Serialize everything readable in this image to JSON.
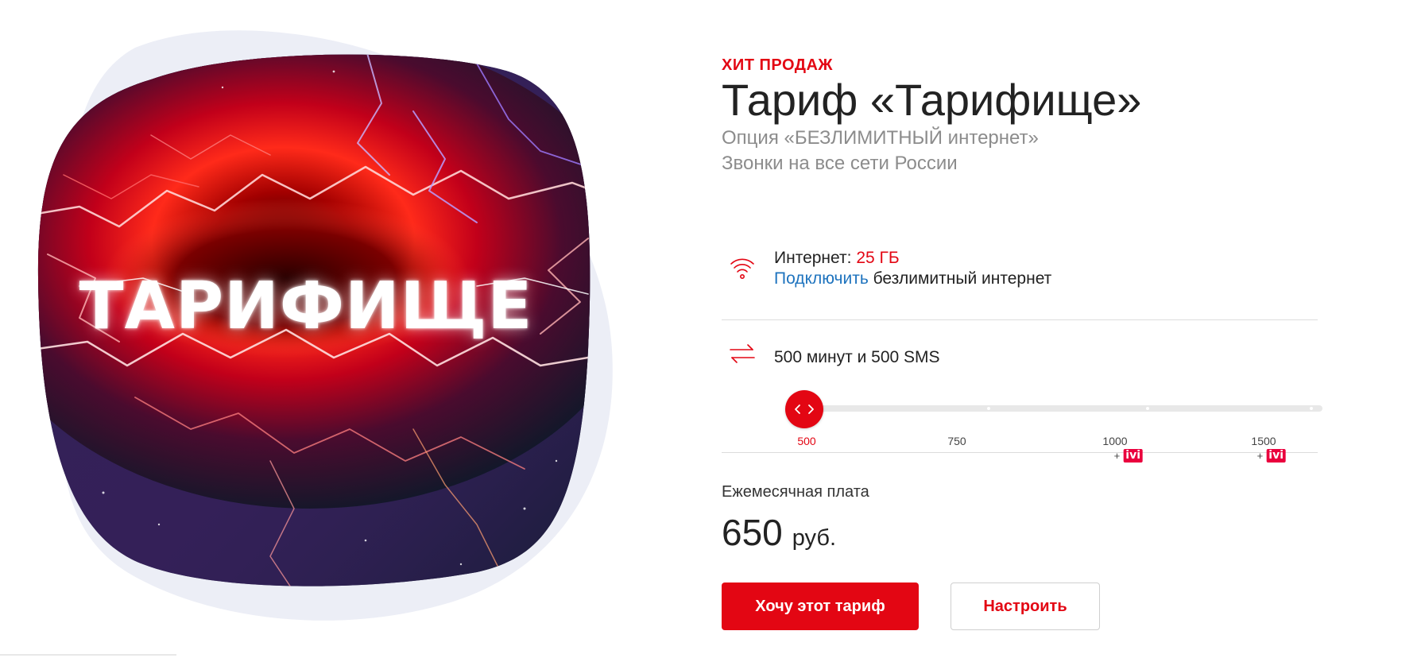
{
  "hero": {
    "word": "ТАРИФИЩЕ",
    "colors": {
      "blob": "#eceef6",
      "glow_red": "#ff1e1e",
      "space_dark": "#0e1626",
      "violet": "#7a3cff"
    }
  },
  "tariff": {
    "badge": "ХИТ ПРОДАЖ",
    "title": "Тариф «Тарифище»",
    "subtitle_lines": [
      "Опция «БЕЗЛИМИТНЫЙ интернет»",
      "Звонки на все сети России"
    ]
  },
  "internet": {
    "icon": "wifi-icon",
    "label": "Интернет: ",
    "value": "25 ГБ",
    "link": "Подключить",
    "link_suffix": " безлимитный интернет"
  },
  "calls": {
    "icon": "exchange-arrows-icon",
    "label": "500 минут и 500 SMS",
    "slider": {
      "options": [
        "500",
        "750",
        "1000",
        "1500"
      ],
      "selected": "500",
      "addons": [
        {
          "option": "1000",
          "prefix": "+",
          "logo": "ivi"
        },
        {
          "option": "1500",
          "prefix": "+",
          "logo": "ivi"
        }
      ]
    }
  },
  "price": {
    "label": "Ежемесячная плата",
    "amount": "650",
    "unit": "руб."
  },
  "buttons": {
    "primary": "Хочу этот тариф",
    "secondary": "Настроить"
  },
  "colors": {
    "accent": "#e30613",
    "link": "#1e73be",
    "muted": "#8c8c8c",
    "ivi": "#ea003d"
  }
}
